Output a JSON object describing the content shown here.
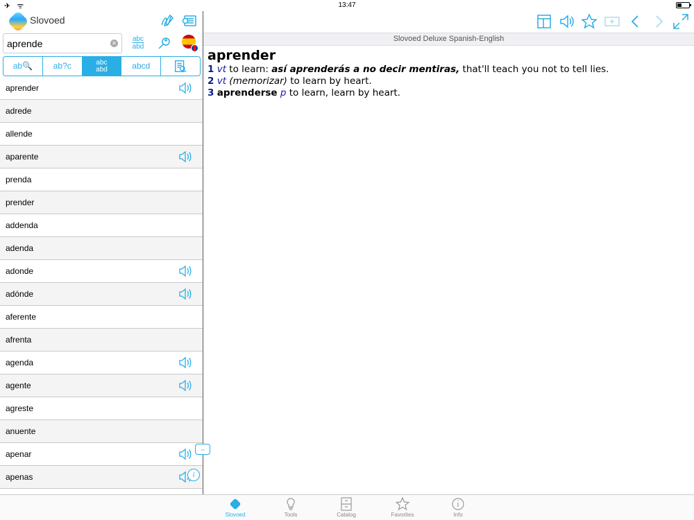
{
  "status": {
    "time": "13:47",
    "left_icons": "✈ ᯤ",
    "battery_level": 0.35
  },
  "left": {
    "app_title": "Slovoed",
    "search": {
      "value": "aprende",
      "placeholder": ""
    },
    "modes": [
      {
        "label": "ab🔍",
        "icon": "fuzzy-search-icon"
      },
      {
        "label": "ab?c",
        "icon": "wildcard-icon"
      },
      {
        "label": "abc abd",
        "icon": "spelling-icon",
        "active": true
      },
      {
        "label": "abcd",
        "icon": "anagram-icon"
      },
      {
        "label": "",
        "icon": "fulltext-search-icon"
      }
    ],
    "words": [
      {
        "word": "aprender",
        "audio": true
      },
      {
        "word": "adrede",
        "audio": false
      },
      {
        "word": "allende",
        "audio": false
      },
      {
        "word": "aparente",
        "audio": true
      },
      {
        "word": "prenda",
        "audio": false
      },
      {
        "word": "prender",
        "audio": false
      },
      {
        "word": "addenda",
        "audio": false
      },
      {
        "word": "adenda",
        "audio": false
      },
      {
        "word": "adonde",
        "audio": true
      },
      {
        "word": "adónde",
        "audio": true
      },
      {
        "word": "aferente",
        "audio": false
      },
      {
        "word": "afrenta",
        "audio": false
      },
      {
        "word": "agenda",
        "audio": true
      },
      {
        "word": "agente",
        "audio": true
      },
      {
        "word": "agreste",
        "audio": false
      },
      {
        "word": "anuente",
        "audio": false
      },
      {
        "word": "apenar",
        "audio": true
      },
      {
        "word": "apenas",
        "audio": true
      },
      {
        "word": "",
        "audio": true
      }
    ],
    "info_label": "i"
  },
  "right": {
    "dictionary_title": "Slovoed Deluxe Spanish-English",
    "headword": "aprender",
    "senses": [
      {
        "num": "1",
        "pos": "vt",
        "text_a": " to learn: ",
        "example": "así aprenderás a no decir mentiras,",
        "text_b": " that'll teach you not to tell lies."
      },
      {
        "num": "2",
        "pos": "vt",
        "note": "(memorizar)",
        "text_a": " to learn by heart."
      },
      {
        "num": "3",
        "form": "aprenderse",
        "pos": "p",
        "text_a": " to learn, learn by heart."
      }
    ]
  },
  "tabs": [
    {
      "label": "Slovoed",
      "icon": "slovoed-icon",
      "active": true
    },
    {
      "label": "Tools",
      "icon": "lightbulb-icon",
      "active": false
    },
    {
      "label": "Catalog",
      "icon": "cabinet-icon",
      "active": false
    },
    {
      "label": "Favorites",
      "icon": "star-icon",
      "active": false
    },
    {
      "label": "Info",
      "icon": "info-icon",
      "active": false
    }
  ],
  "colors": {
    "accent": "#29aee6",
    "sense_number": "#0a1a8c"
  }
}
